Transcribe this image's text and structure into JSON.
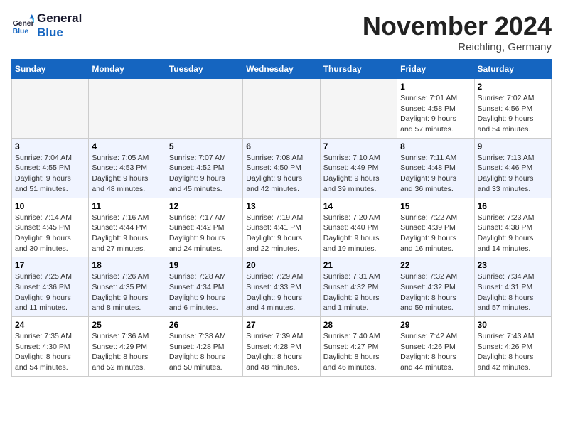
{
  "logo": {
    "line1": "General",
    "line2": "Blue"
  },
  "title": "November 2024",
  "location": "Reichling, Germany",
  "days_header": [
    "Sunday",
    "Monday",
    "Tuesday",
    "Wednesday",
    "Thursday",
    "Friday",
    "Saturday"
  ],
  "weeks": [
    [
      {
        "date": "",
        "detail": ""
      },
      {
        "date": "",
        "detail": ""
      },
      {
        "date": "",
        "detail": ""
      },
      {
        "date": "",
        "detail": ""
      },
      {
        "date": "",
        "detail": ""
      },
      {
        "date": "1",
        "detail": "Sunrise: 7:01 AM\nSunset: 4:58 PM\nDaylight: 9 hours\nand 57 minutes."
      },
      {
        "date": "2",
        "detail": "Sunrise: 7:02 AM\nSunset: 4:56 PM\nDaylight: 9 hours\nand 54 minutes."
      }
    ],
    [
      {
        "date": "3",
        "detail": "Sunrise: 7:04 AM\nSunset: 4:55 PM\nDaylight: 9 hours\nand 51 minutes."
      },
      {
        "date": "4",
        "detail": "Sunrise: 7:05 AM\nSunset: 4:53 PM\nDaylight: 9 hours\nand 48 minutes."
      },
      {
        "date": "5",
        "detail": "Sunrise: 7:07 AM\nSunset: 4:52 PM\nDaylight: 9 hours\nand 45 minutes."
      },
      {
        "date": "6",
        "detail": "Sunrise: 7:08 AM\nSunset: 4:50 PM\nDaylight: 9 hours\nand 42 minutes."
      },
      {
        "date": "7",
        "detail": "Sunrise: 7:10 AM\nSunset: 4:49 PM\nDaylight: 9 hours\nand 39 minutes."
      },
      {
        "date": "8",
        "detail": "Sunrise: 7:11 AM\nSunset: 4:48 PM\nDaylight: 9 hours\nand 36 minutes."
      },
      {
        "date": "9",
        "detail": "Sunrise: 7:13 AM\nSunset: 4:46 PM\nDaylight: 9 hours\nand 33 minutes."
      }
    ],
    [
      {
        "date": "10",
        "detail": "Sunrise: 7:14 AM\nSunset: 4:45 PM\nDaylight: 9 hours\nand 30 minutes."
      },
      {
        "date": "11",
        "detail": "Sunrise: 7:16 AM\nSunset: 4:44 PM\nDaylight: 9 hours\nand 27 minutes."
      },
      {
        "date": "12",
        "detail": "Sunrise: 7:17 AM\nSunset: 4:42 PM\nDaylight: 9 hours\nand 24 minutes."
      },
      {
        "date": "13",
        "detail": "Sunrise: 7:19 AM\nSunset: 4:41 PM\nDaylight: 9 hours\nand 22 minutes."
      },
      {
        "date": "14",
        "detail": "Sunrise: 7:20 AM\nSunset: 4:40 PM\nDaylight: 9 hours\nand 19 minutes."
      },
      {
        "date": "15",
        "detail": "Sunrise: 7:22 AM\nSunset: 4:39 PM\nDaylight: 9 hours\nand 16 minutes."
      },
      {
        "date": "16",
        "detail": "Sunrise: 7:23 AM\nSunset: 4:38 PM\nDaylight: 9 hours\nand 14 minutes."
      }
    ],
    [
      {
        "date": "17",
        "detail": "Sunrise: 7:25 AM\nSunset: 4:36 PM\nDaylight: 9 hours\nand 11 minutes."
      },
      {
        "date": "18",
        "detail": "Sunrise: 7:26 AM\nSunset: 4:35 PM\nDaylight: 9 hours\nand 8 minutes."
      },
      {
        "date": "19",
        "detail": "Sunrise: 7:28 AM\nSunset: 4:34 PM\nDaylight: 9 hours\nand 6 minutes."
      },
      {
        "date": "20",
        "detail": "Sunrise: 7:29 AM\nSunset: 4:33 PM\nDaylight: 9 hours\nand 4 minutes."
      },
      {
        "date": "21",
        "detail": "Sunrise: 7:31 AM\nSunset: 4:32 PM\nDaylight: 9 hours\nand 1 minute."
      },
      {
        "date": "22",
        "detail": "Sunrise: 7:32 AM\nSunset: 4:32 PM\nDaylight: 8 hours\nand 59 minutes."
      },
      {
        "date": "23",
        "detail": "Sunrise: 7:34 AM\nSunset: 4:31 PM\nDaylight: 8 hours\nand 57 minutes."
      }
    ],
    [
      {
        "date": "24",
        "detail": "Sunrise: 7:35 AM\nSunset: 4:30 PM\nDaylight: 8 hours\nand 54 minutes."
      },
      {
        "date": "25",
        "detail": "Sunrise: 7:36 AM\nSunset: 4:29 PM\nDaylight: 8 hours\nand 52 minutes."
      },
      {
        "date": "26",
        "detail": "Sunrise: 7:38 AM\nSunset: 4:28 PM\nDaylight: 8 hours\nand 50 minutes."
      },
      {
        "date": "27",
        "detail": "Sunrise: 7:39 AM\nSunset: 4:28 PM\nDaylight: 8 hours\nand 48 minutes."
      },
      {
        "date": "28",
        "detail": "Sunrise: 7:40 AM\nSunset: 4:27 PM\nDaylight: 8 hours\nand 46 minutes."
      },
      {
        "date": "29",
        "detail": "Sunrise: 7:42 AM\nSunset: 4:26 PM\nDaylight: 8 hours\nand 44 minutes."
      },
      {
        "date": "30",
        "detail": "Sunrise: 7:43 AM\nSunset: 4:26 PM\nDaylight: 8 hours\nand 42 minutes."
      }
    ]
  ]
}
